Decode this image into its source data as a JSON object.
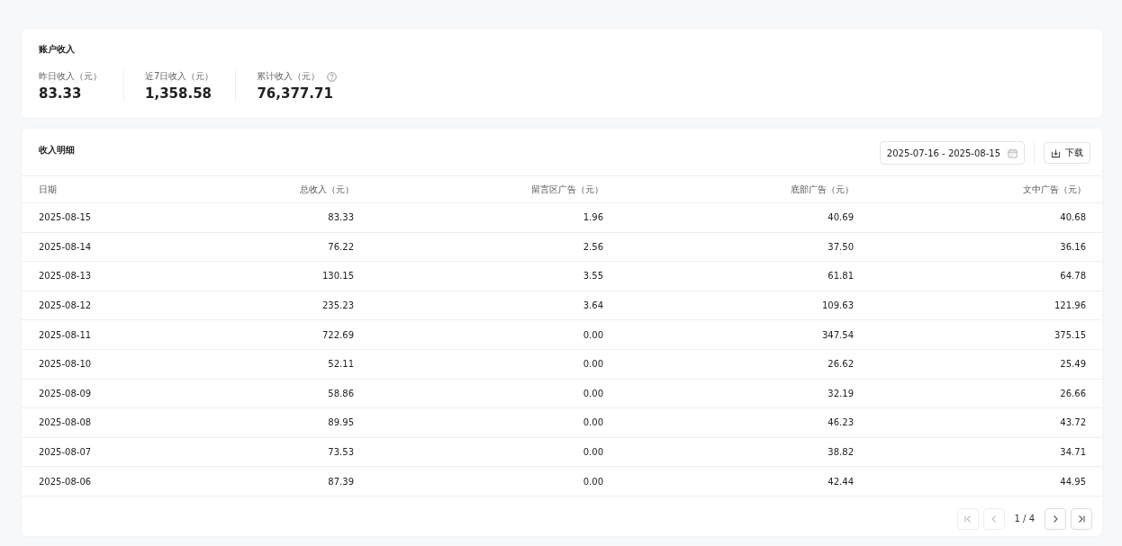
{
  "summary": {
    "title": "账户收入",
    "stats": [
      {
        "label": "昨日收入（元）",
        "value": "83.33"
      },
      {
        "label": "近7日收入（元）",
        "value": "1,358.58"
      },
      {
        "label": "累计收入（元）",
        "value": "76,377.71",
        "help": true
      }
    ]
  },
  "detail": {
    "title": "收入明细",
    "date_range": "2025-07-16 - 2025-08-15",
    "download_label": "下载",
    "columns": [
      "日期",
      "总收入（元）",
      "留言区广告（元）",
      "底部广告（元）",
      "文中广告（元）"
    ],
    "rows": [
      [
        "2025-08-15",
        "83.33",
        "1.96",
        "40.69",
        "40.68"
      ],
      [
        "2025-08-14",
        "76.22",
        "2.56",
        "37.50",
        "36.16"
      ],
      [
        "2025-08-13",
        "130.15",
        "3.55",
        "61.81",
        "64.78"
      ],
      [
        "2025-08-12",
        "235.23",
        "3.64",
        "109.63",
        "121.96"
      ],
      [
        "2025-08-11",
        "722.69",
        "0.00",
        "347.54",
        "375.15"
      ],
      [
        "2025-08-10",
        "52.11",
        "0.00",
        "26.62",
        "25.49"
      ],
      [
        "2025-08-09",
        "58.86",
        "0.00",
        "32.19",
        "26.66"
      ],
      [
        "2025-08-08",
        "89.95",
        "0.00",
        "46.23",
        "43.72"
      ],
      [
        "2025-08-07",
        "73.53",
        "0.00",
        "38.82",
        "34.71"
      ],
      [
        "2025-08-06",
        "87.39",
        "0.00",
        "42.44",
        "44.95"
      ]
    ],
    "pagination": {
      "page_text": "1 / 4",
      "first_disabled": true,
      "prev_disabled": true,
      "next_disabled": false,
      "last_disabled": false
    }
  }
}
